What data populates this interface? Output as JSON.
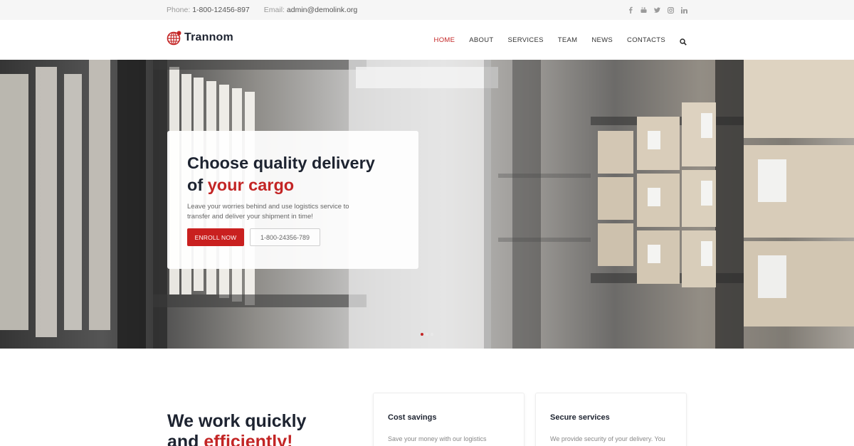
{
  "topbar": {
    "phone_label": "Phone:",
    "phone_value": "1-800-12456-897",
    "email_label": "Email:",
    "email_value": "admin@demolink.org",
    "socials": [
      "facebook-icon",
      "youtube-icon",
      "twitter-icon",
      "instagram-icon",
      "linkedin-icon"
    ]
  },
  "header": {
    "logo_text": "Trannom",
    "nav": [
      {
        "label": "HOME",
        "active": true
      },
      {
        "label": "ABOUT",
        "active": false
      },
      {
        "label": "SERVICES",
        "active": false
      },
      {
        "label": "TEAM",
        "active": false
      },
      {
        "label": "NEWS",
        "active": false
      },
      {
        "label": "CONTACTS",
        "active": false
      }
    ],
    "search_icon": "search-icon"
  },
  "hero": {
    "title_line1": "Choose quality delivery",
    "title_line2_prefix": "of ",
    "title_line2_accent": "your cargo",
    "description": "Leave your worries behind and use logistics service to transfer and deliver your shipment in time!",
    "primary_button": "ENROLL NOW",
    "secondary_button": "1-800-24356-789",
    "slides": 3,
    "active_slide": 1
  },
  "section": {
    "title_line1": "We work quickly",
    "title_line2_prefix": "and ",
    "title_line2_accent": "efficiently!",
    "features": [
      {
        "title": "Cost savings",
        "text": "Save your money with our logistics"
      },
      {
        "title": "Secure services",
        "text": "We provide security of your delivery. You"
      }
    ]
  },
  "colors": {
    "accent": "#c32525",
    "button": "#c9201f",
    "heading": "#1d2330",
    "topbar_bg": "#f6f6f6"
  }
}
